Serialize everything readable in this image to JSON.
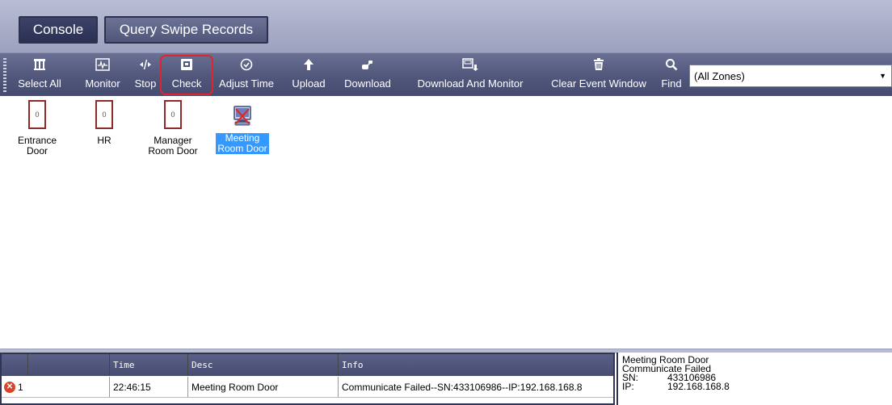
{
  "tabs": {
    "console": "Console",
    "query": "Query Swipe Records"
  },
  "toolbar": {
    "select_all": "Select All",
    "monitor": "Monitor",
    "stop": "Stop",
    "check": "Check",
    "adjust_time": "Adjust Time",
    "upload": "Upload",
    "download": "Download",
    "download_monitor": "Download And Monitor",
    "clear_event": "Clear Event Window",
    "find": "Find",
    "zone_value": "(All Zones)"
  },
  "doors": [
    {
      "name": "Entrance Door",
      "line1": "Entrance",
      "line2": "Door",
      "count": "0"
    },
    {
      "name": "HR",
      "line1": "HR",
      "line2": "",
      "count": "0"
    },
    {
      "name": "Manager Room Door",
      "line1": "Manager",
      "line2": "Room  Door",
      "count": "0"
    },
    {
      "name": "Meeting Room Door",
      "line1": "Meeting",
      "line2": "Room Door",
      "selected": true
    }
  ],
  "events": {
    "columns": [
      "",
      "Time",
      "Desc",
      "Info"
    ],
    "rows": [
      {
        "index": "1",
        "time": "22:46:15",
        "desc": "Meeting Room Door",
        "info": "Communicate Failed--SN:433106986--IP:192.168.168.8"
      }
    ]
  },
  "detail": {
    "door": "Meeting Room Door",
    "status": "Communicate Failed",
    "sn_label": "SN:",
    "sn_value": "433106986",
    "ip_label": "IP:",
    "ip_value": "192.168.168.8"
  },
  "colors": {
    "toolbar": "#50577b",
    "highlight": "#e2232a",
    "selected": "#3399ff",
    "door_frame": "#8e2a2a"
  }
}
